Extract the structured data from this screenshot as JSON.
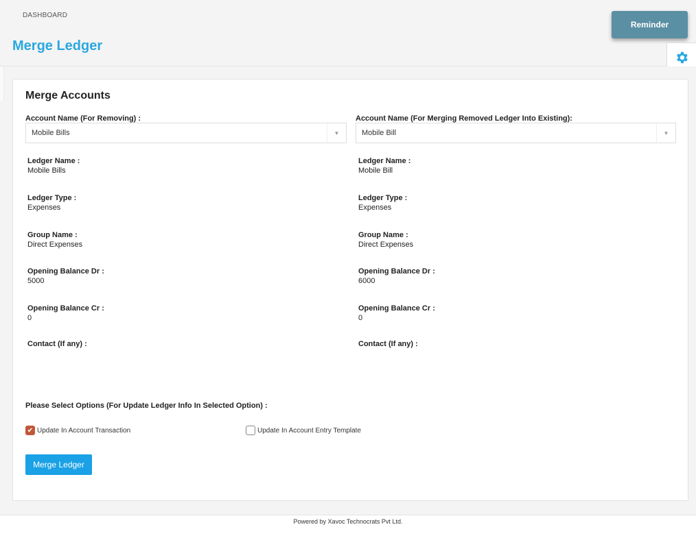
{
  "header": {
    "breadcrumb": "DASHBOARD",
    "title": "Merge Ledger",
    "reminder_label": "Reminder",
    "settings_icon": "gear-icon"
  },
  "panel": {
    "title": "Merge Accounts",
    "left": {
      "select_label": "Account Name (For Removing) :",
      "selected_value": "Mobile Bills",
      "fields": [
        {
          "label": "Ledger Name :",
          "value": "Mobile Bills"
        },
        {
          "label": "Ledger Type :",
          "value": "Expenses"
        },
        {
          "label": "Group Name :",
          "value": "Direct Expenses"
        },
        {
          "label": "Opening Balance Dr :",
          "value": "5000"
        },
        {
          "label": "Opening Balance Cr :",
          "value": "0"
        },
        {
          "label": "Contact (If any) :",
          "value": ""
        }
      ]
    },
    "right": {
      "select_label": "Account Name (For Merging Removed Ledger Into Existing):",
      "selected_value": "Mobile Bill",
      "fields": [
        {
          "label": "Ledger Name :",
          "value": "Mobile Bill"
        },
        {
          "label": "Ledger Type :",
          "value": "Expenses"
        },
        {
          "label": "Group Name :",
          "value": "Direct Expenses"
        },
        {
          "label": "Opening Balance Dr :",
          "value": "6000"
        },
        {
          "label": "Opening Balance Cr :",
          "value": "0"
        },
        {
          "label": "Contact (If any) :",
          "value": ""
        }
      ]
    },
    "options_label": "Please Select Options (For Update Ledger Info In Selected Option) :",
    "options": [
      {
        "label": "Update In Account Transaction",
        "checked": true
      },
      {
        "label": "Update In Account Entry Template",
        "checked": false
      }
    ],
    "merge_button_label": "Merge Ledger"
  },
  "footer": {
    "text": "Powered by Xavoc Technocrats Pvt Ltd."
  },
  "colors": {
    "accent": "#2aa8e0",
    "button": "#1aa1e6",
    "reminder": "#5b8fa3",
    "checkbox": "#c0583a"
  }
}
